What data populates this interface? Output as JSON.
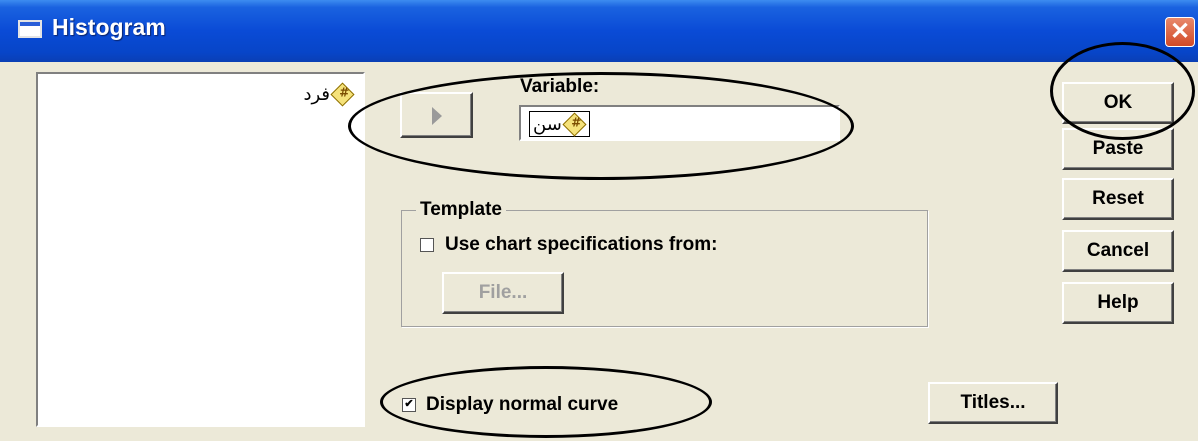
{
  "window": {
    "title": "Histogram",
    "close_symbol": "✕"
  },
  "variables_list": [
    {
      "name": "فرد",
      "type_icon": "scale-variable-icon",
      "icon_glyph": "#"
    }
  ],
  "variable": {
    "label": "Variable:",
    "value": "سن",
    "type_icon": "scale-variable-icon",
    "icon_glyph": "#"
  },
  "template": {
    "group_label": "Template",
    "use_chart_spec_label": "Use chart specifications from:",
    "use_chart_spec_checked": false,
    "file_button": "File..."
  },
  "display_normal_curve": {
    "label": "Display normal curve",
    "checked": true,
    "check_mark": "✔"
  },
  "buttons": {
    "ok": "OK",
    "paste": "Paste",
    "reset": "Reset",
    "cancel": "Cancel",
    "help": "Help",
    "titles": "Titles..."
  },
  "colors": {
    "titlebar": "#0a4bd6",
    "dialog_bg": "#ece9d8",
    "close_button": "#d24a27"
  }
}
